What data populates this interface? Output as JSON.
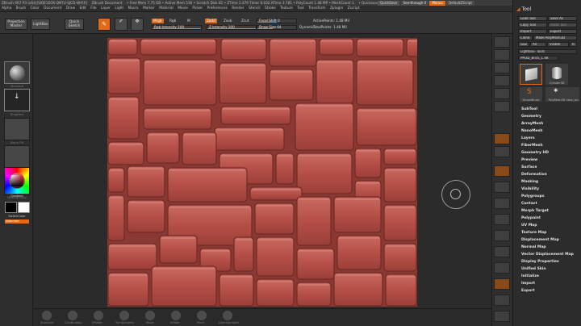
{
  "title_bar": [
    "ZBrush 4R7 P3 (x64)[SIQE1EOX-QNTU-SJCD-NHYX]",
    "ZBrush Document",
    "• Free Mem 7.75 GB • Active Mem 530 • Scratch Disk 81 • ZTime 1.479 Timer 0.032 ATime 3.781 • PolyCount 1.48 MP • MeshCount 1",
    "• Quicksave"
  ],
  "title_right": {
    "quicksave": "QuickSave",
    "seethrough": "See-through",
    "seethrough_val": "0",
    "menus": "Menus",
    "defaultzscript": "DefaultZScript"
  },
  "menus": [
    "Alpha",
    "Brush",
    "Color",
    "Document",
    "Draw",
    "Edit",
    "File",
    "Layer",
    "Light",
    "Macro",
    "Marker",
    "Material",
    "Movie",
    "Picker",
    "Preferences",
    "Render",
    "Stencil",
    "Stroke",
    "Texture",
    "Tool",
    "Transform",
    "Zplugin",
    "Zscript"
  ],
  "toolbar": {
    "projection_master": "Projection Master",
    "lightbox": "LightBox",
    "quick_sketch": "Quick Sketch",
    "edit": "Edit",
    "mrgb": "Mrgb",
    "rgb": "Rgb",
    "m": "M",
    "rgb_intensity": "Rgb Intensity 100",
    "zadd": "Zadd",
    "zsub": "Zsub",
    "zcut": "Zcut",
    "z_intensity": "Z Intensity 100",
    "focal_shift": "Focal Shift 0",
    "draw_size": "Draw Size 64",
    "dynamic": "Dynamic",
    "active_points": "ActivePoints: 1.48 Mil",
    "total_points": "TotalPoints: 1.48 Mil"
  },
  "left_tray": {
    "standard": "Standard",
    "dots": "DragRect",
    "alpha_off": "Alpha Off",
    "texture_off": "Texture Off",
    "material": "MatCap Gray",
    "gradient": "Gradient",
    "switch_color": "SwitchColor",
    "alternate": "Alternate"
  },
  "tool_panel": {
    "title": "Tool",
    "load_tool": "Load Tool",
    "save_as": "Save As",
    "copy_tool": "Copy Tool",
    "paste_tool": "Paste Tool",
    "import": "Import",
    "export": "Export",
    "clone": "Clone",
    "make_polymesh": "Make PolyMesh3D",
    "goz": "GoZ",
    "all": "All",
    "visible": "Visible",
    "r": "R",
    "lightbox_tools": "Lightbox› Tools",
    "current_tool": "PM3D_Brick_1.48",
    "tool_thumbs": [
      "",
      "Cylinder3D",
      "SimpleBrush",
      "PolyMesh3D",
      "PM3D_Brick"
    ],
    "sections": [
      "SubTool",
      "Geometry",
      "ArrayMesh",
      "NanoMesh",
      "Layers",
      "FiberMesh",
      "Geometry HD",
      "Preview",
      "Surface",
      "Deformation",
      "Masking",
      "Visibility",
      "Polygroups",
      "Contact",
      "Morph Target",
      "Polypaint",
      "UV Map",
      "Texture Map",
      "Displacement Map",
      "Normal Map",
      "Vector Displacement Map",
      "Display Properties",
      "Unified Skin",
      "Initialize",
      "Import",
      "Export"
    ]
  },
  "bottom_labels": [
    "Standard",
    "ClayBuildup",
    "hPolish",
    "TrimDynamic",
    "Move",
    "Inflate",
    "Pinch",
    "DamStandard"
  ],
  "colors": {
    "accent": "#e06a18",
    "brick": "#b95048",
    "mortar": "#8f3b36"
  }
}
